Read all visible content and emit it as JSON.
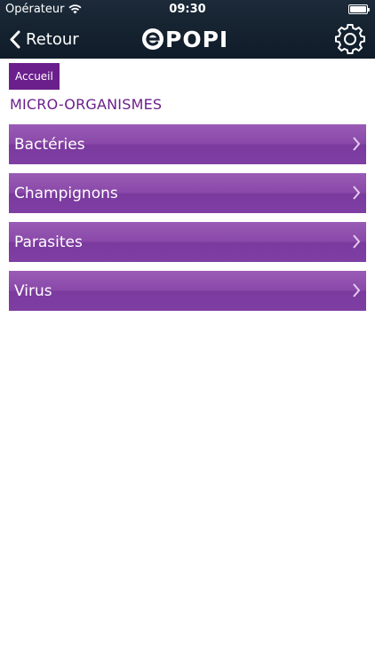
{
  "status_bar": {
    "carrier": "Opérateur",
    "time": "09:30"
  },
  "nav": {
    "back_label": "Retour",
    "logo_text": "POPI"
  },
  "breadcrumb": {
    "home_label": "Accueil"
  },
  "page": {
    "title": "MICRO-ORGANISMES"
  },
  "items": [
    {
      "label": "Bactéries"
    },
    {
      "label": "Champignons"
    },
    {
      "label": "Parasites"
    },
    {
      "label": "Virus"
    }
  ],
  "colors": {
    "accent": "#6b1f8c",
    "item_gradient_top": "#9a5bb6",
    "item_gradient_bottom": "#7f3ea3",
    "nav_background": "#1c2a39"
  }
}
